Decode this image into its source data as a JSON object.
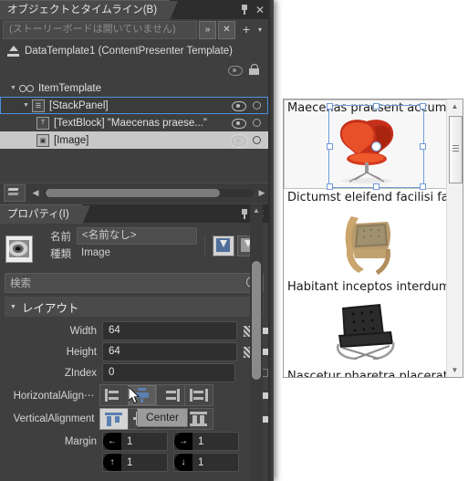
{
  "objects_pane": {
    "tab_label": "オブジェクトとタイムライン(B)",
    "storyboard_placeholder": "(ストーリーボードは開いていません)",
    "storyboard_value": "",
    "btn_chevrons": "»",
    "btn_close_sb": "✕",
    "btn_new": "+",
    "btn_caret": "▾",
    "pin_title": "",
    "close_title": "",
    "root_label": "DataTemplate1 (ContentPresenter Template)",
    "tree": [
      {
        "label": "ItemTemplate",
        "icon": "glasses-icon",
        "twisty": "▼",
        "indent": 8,
        "state": "normal",
        "right": "none"
      },
      {
        "label": "[StackPanel]",
        "icon": "stackpanel-icon",
        "twisty": "▼",
        "indent": 22,
        "state": "outlined",
        "right": "eye-dot"
      },
      {
        "label": "[TextBlock] \"Maecenas praese...\"",
        "icon": "textblock-icon",
        "twisty": "",
        "indent": 40,
        "state": "normal",
        "right": "eye-dot"
      },
      {
        "label": "[Image]",
        "icon": "image-icon",
        "twisty": "",
        "indent": 40,
        "state": "selected",
        "right": "eye-strong-dot"
      }
    ]
  },
  "properties_pane": {
    "tab_label": "プロパティ(I)",
    "name_label": "名前",
    "name_value": "<名前なし>",
    "type_label": "種類",
    "type_value": "Image",
    "search_placeholder": "検索",
    "section_layout": "レイアウト",
    "rows": [
      {
        "label": "Width",
        "value": "64"
      },
      {
        "label": "Height",
        "value": "64"
      },
      {
        "label": "ZIndex",
        "value": "0"
      }
    ],
    "horizontal_label": "HorizontalAlign⋯",
    "horizontal_options": [
      "Left",
      "Center",
      "Right",
      "Stretch"
    ],
    "horizontal_selected": "Center",
    "vertical_label": "VerticalAlignment",
    "vertical_options": [
      "Top",
      "Center",
      "Bottom",
      "Stretch"
    ],
    "vertical_selected": "Top",
    "tooltip_text": "Center",
    "margin_label": "Margin",
    "margin": {
      "left": "1",
      "right": "1",
      "top": "1",
      "bottom": "1"
    }
  },
  "preview": {
    "items": [
      {
        "text": "Maecenas praesent accumsa",
        "chair": "swan-red",
        "selected": true
      },
      {
        "text": "Dictumst eleifend facilisi fau",
        "chair": "wood-tan",
        "selected": false
      },
      {
        "text": "Habitant inceptos interdum l",
        "chair": "barcelona-black",
        "selected": false
      },
      {
        "text": "Nascetur pharetra placerat p",
        "chair": "wood-light",
        "selected": false
      }
    ],
    "scroll_up": "▲",
    "scroll_down": "▼"
  },
  "colors": {
    "panel_bg": "#3f3f3f",
    "tab_bg": "#2d2d2d",
    "selection_blue": "#4d90e0",
    "accent_blue": "#5a7fb0",
    "selected_row": "#c8c8c8",
    "preview_bg": "#ffffff",
    "adorner_blue": "#6f9ad6"
  }
}
